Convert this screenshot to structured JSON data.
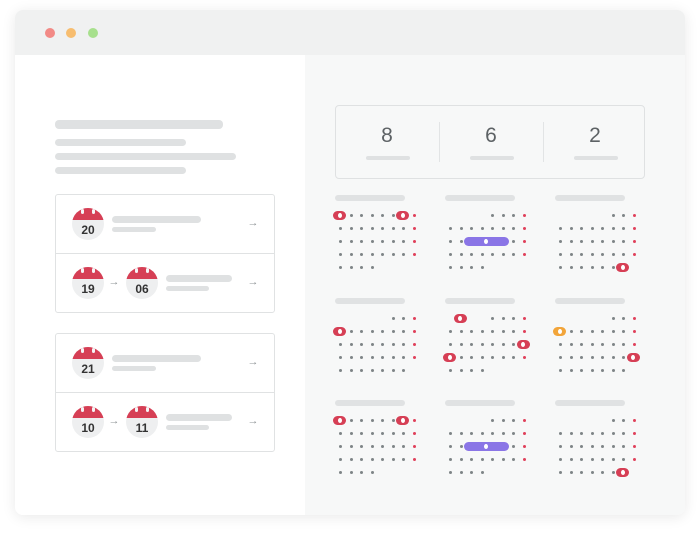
{
  "window": {
    "controls": [
      "close",
      "minimize",
      "maximize"
    ]
  },
  "colors": {
    "accent_red": "#d63f55",
    "range_purple": "#8a75e6",
    "today_orange": "#f2a53a",
    "weekend_red": "#e0405a"
  },
  "bookings": [
    {
      "rows": [
        {
          "start": "20",
          "end": null
        },
        {
          "start": "19",
          "end": "06"
        }
      ]
    },
    {
      "rows": [
        {
          "start": "21",
          "end": null
        },
        {
          "start": "10",
          "end": "11"
        }
      ]
    }
  ],
  "stats": [
    {
      "value": "8"
    },
    {
      "value": "6"
    },
    {
      "value": "2"
    }
  ],
  "icons": {
    "arrow": "→"
  }
}
